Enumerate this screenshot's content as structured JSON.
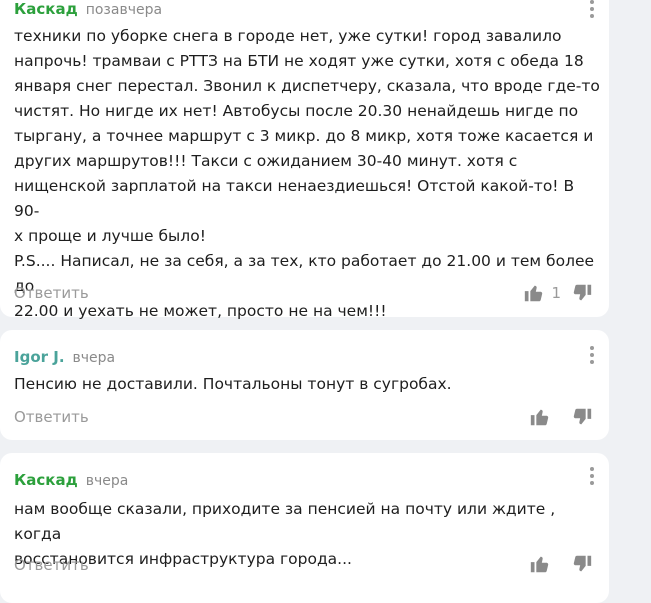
{
  "comments": [
    {
      "author": "Каскад",
      "author_color": "#2ca03c",
      "time": "позавчера",
      "text_lines": [
        "техники по уборке снега в городе нет, уже сутки! город завалило",
        "напрочь! трамваи с РТТЗ на БТИ не ходят уже сутки, хотя с обеда 18",
        "января снег перестал. Звонил к диспетчеру, сказала, что вроде где-то",
        "чистят. Но нигде их нет! Автобусы после 20.30 ненайдешь нигде по",
        "тыргану, а точнее маршрут с 3 микр. до 8 микр, хотя тоже касается и",
        "других маршрутов!!! Такси с ожиданием 30-40 минут. хотя с",
        "нищенской зарплатой на такси ненаездиешься! Отстой какой-то! В 90-",
        "х проще и лучше было!",
        "P.S.... Написал, не за себя, а за тех, кто работает до 21.00 и тем более до",
        "22.00 и уехать не может, просто не на чем!!!"
      ],
      "reply_label": "Ответить",
      "likes": "1"
    },
    {
      "author": "Igor J.",
      "author_color": "#4aa39a",
      "time": "вчера",
      "text_lines": [
        "Пенсию не доставили. Почтальоны тонут в сугробах."
      ],
      "reply_label": "Ответить",
      "likes": ""
    },
    {
      "author": "Каскад",
      "author_color": "#2ca03c",
      "time": "вчера",
      "text_lines": [
        "нам вообще сказали, приходите за пенсией на почту или ждите , когда",
        "восстановится инфраструктура города..."
      ],
      "reply_label": "Ответить",
      "likes": ""
    }
  ],
  "icons": {
    "like": "thumbs-up-icon",
    "dislike": "thumbs-down-icon",
    "more": "more-vertical-icon"
  },
  "colors": {
    "page_bg": "#eff1f4",
    "card_bg": "#ffffff",
    "muted": "#9a9a9a",
    "icon": "#8a8a8a"
  }
}
